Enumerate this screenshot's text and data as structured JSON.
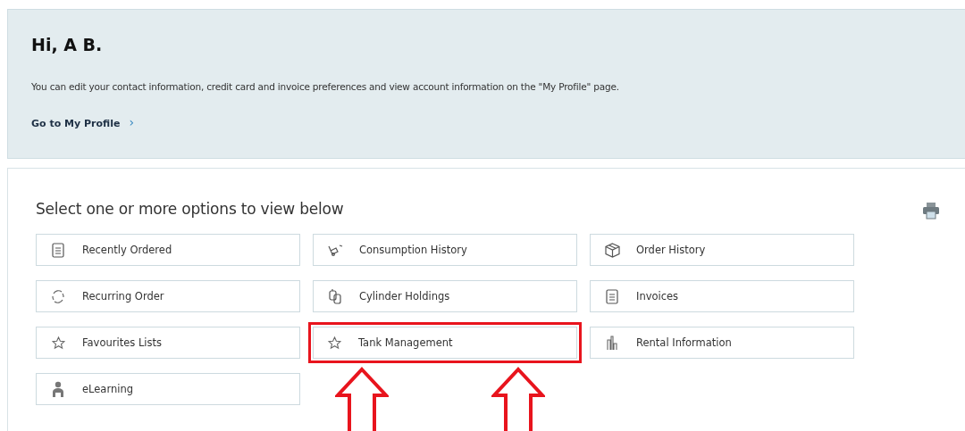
{
  "greeting": {
    "title": "Hi, A B.",
    "text": "You can edit your contact information, credit card and invoice preferences and view account information on the \"My Profile\" page.",
    "link": "Go to My Profile",
    "link_chevron": "›"
  },
  "options_panel": {
    "title": "Select one or more options to view below",
    "options": [
      {
        "label": "Recently Ordered",
        "kind": "list",
        "highlighted": false
      },
      {
        "label": "Consumption History",
        "kind": "truck",
        "highlighted": false
      },
      {
        "label": "Order History",
        "kind": "box",
        "highlighted": false
      },
      {
        "label": "Recurring Order",
        "kind": "cycle",
        "highlighted": false
      },
      {
        "label": "Cylinder Holdings",
        "kind": "cylinders",
        "highlighted": false
      },
      {
        "label": "Invoices",
        "kind": "list",
        "highlighted": false
      },
      {
        "label": "Favourites Lists",
        "kind": "star",
        "highlighted": false
      },
      {
        "label": "Tank Management",
        "kind": "star",
        "highlighted": true
      },
      {
        "label": "Rental Information",
        "kind": "bars",
        "highlighted": false
      },
      {
        "label": "eLearning",
        "kind": "person",
        "highlighted": false
      }
    ],
    "arrows": [
      {
        "kind": "up"
      },
      {
        "kind": "up"
      }
    ]
  }
}
